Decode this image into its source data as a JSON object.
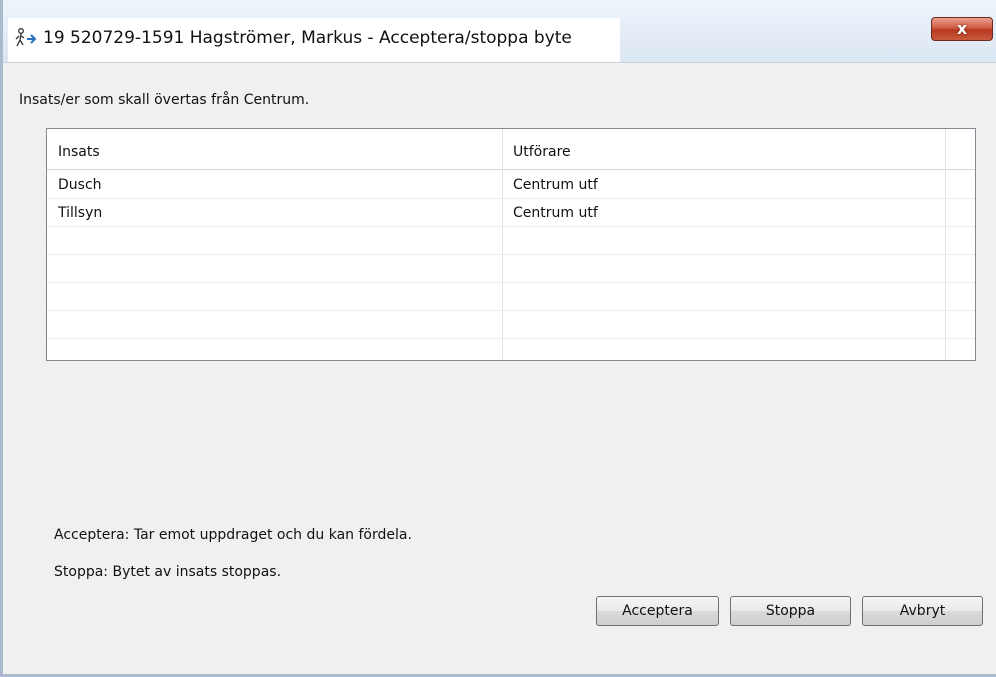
{
  "window": {
    "title": "19 520729-1591 Hagströmer, Markus - Acceptera/stoppa byte",
    "close_label": "x"
  },
  "heading": "Insats/er som skall övertas från Centrum.",
  "table": {
    "columns": [
      "Insats",
      "Utförare"
    ],
    "rows": [
      [
        "Dusch",
        "Centrum utf"
      ],
      [
        "Tillsyn",
        "Centrum utf"
      ],
      [
        "",
        ""
      ],
      [
        "",
        ""
      ],
      [
        "",
        ""
      ],
      [
        "",
        ""
      ],
      [
        "",
        ""
      ]
    ]
  },
  "info": {
    "accept_text": "Acceptera: Tar emot uppdraget och du kan fördela.",
    "stop_text": "Stoppa: Bytet av insats stoppas."
  },
  "buttons": {
    "accept": "Acceptera",
    "stop": "Stoppa",
    "cancel": "Avbryt"
  }
}
